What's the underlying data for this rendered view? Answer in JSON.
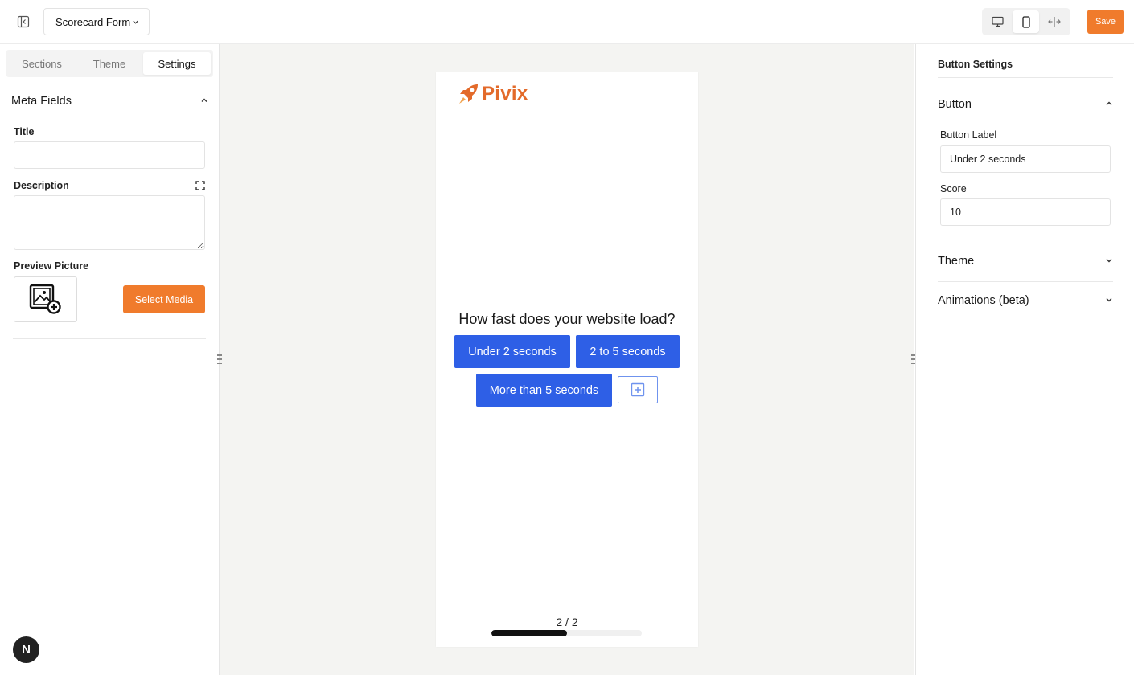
{
  "topbar": {
    "form_name": "Scorecard Form",
    "save_label": "Save",
    "devices": [
      "desktop",
      "mobile",
      "custom-width"
    ],
    "active_device": "mobile"
  },
  "left": {
    "tabs": [
      {
        "label": "Sections",
        "active": false
      },
      {
        "label": "Theme",
        "active": false
      },
      {
        "label": "Settings",
        "active": true
      }
    ],
    "meta_fields_title": "Meta Fields",
    "title_label": "Title",
    "title_value": "",
    "description_label": "Description",
    "description_value": "",
    "preview_label": "Preview Picture",
    "select_media_label": "Select Media",
    "avatar_letter": "N"
  },
  "canvas": {
    "brand": "Pivix",
    "question": "How fast does your website load?",
    "answers": [
      "Under 2 seconds",
      "2 to 5 seconds",
      "More than 5 seconds"
    ],
    "page_indicator": "2 / 2",
    "progress": 0.5
  },
  "right": {
    "title": "Button Settings",
    "button_section": "Button",
    "button_label_label": "Button Label",
    "button_label_value": "Under 2 seconds",
    "score_label": "Score",
    "score_value": "10",
    "theme_section": "Theme",
    "animations_section": "Animations (beta)"
  },
  "colors": {
    "accent": "#f07b2c",
    "answer_button": "#2e5fe6",
    "brand": "#e36a2a"
  }
}
